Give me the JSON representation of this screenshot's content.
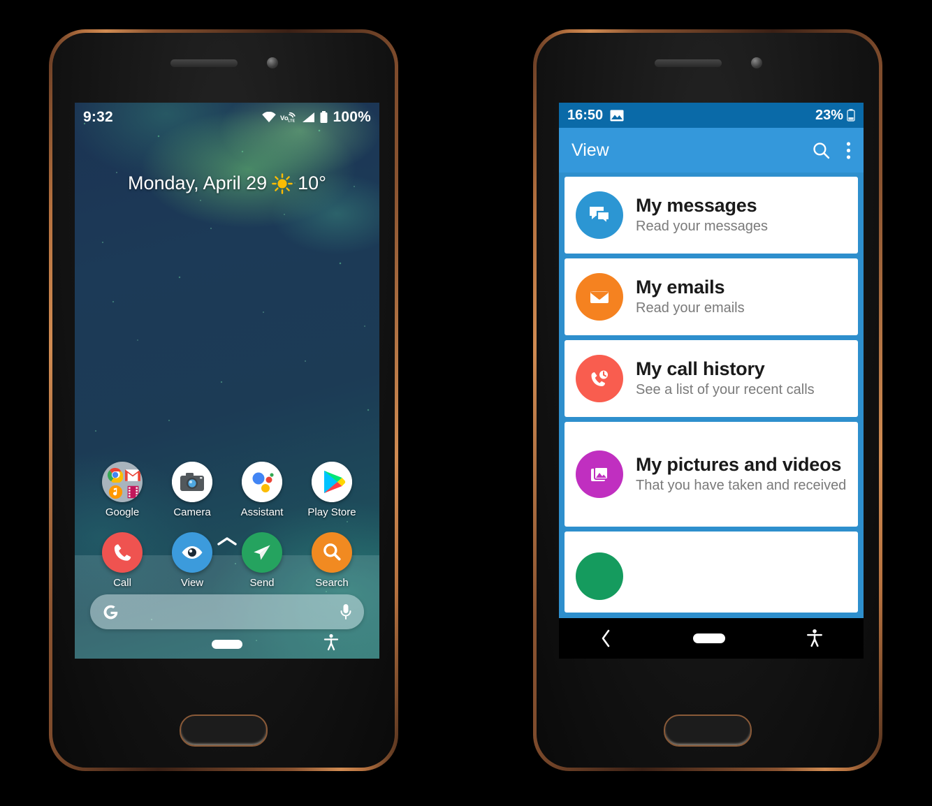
{
  "left_phone": {
    "name": "android-home-screen",
    "status_bar": {
      "time": "9:32",
      "wifi_icon": "wifi-icon",
      "volte_icon": "volte-icon",
      "signal_icon": "cellular-signal-icon",
      "battery_icon": "battery-icon",
      "battery_percent": "100%"
    },
    "date_widget": {
      "date": "Monday, April 29",
      "weather_icon": "sun-icon",
      "temperature": "10°"
    },
    "apps": [
      {
        "label": "Google",
        "icon": "google-folder-icon"
      },
      {
        "label": "Camera",
        "icon": "camera-icon"
      },
      {
        "label": "Assistant",
        "icon": "google-assistant-icon"
      },
      {
        "label": "Play Store",
        "icon": "play-store-icon"
      }
    ],
    "app_drawer_handle_icon": "chevron-up-icon",
    "dock": [
      {
        "label": "Call",
        "icon": "phone-icon",
        "color": "#EF5350"
      },
      {
        "label": "View",
        "icon": "eye-icon",
        "color": "#3C9BDC"
      },
      {
        "label": "Send",
        "icon": "paper-plane-icon",
        "color": "#25A35F"
      },
      {
        "label": "Search",
        "icon": "magnifier-icon",
        "color": "#F18A21"
      }
    ],
    "search_widget": {
      "logo_icon": "google-g-icon",
      "mic_icon": "microphone-icon",
      "query": ""
    },
    "nav_bar": {
      "home_icon": "home-pill-icon",
      "accessibility_icon": "accessibility-icon"
    }
  },
  "right_phone": {
    "name": "view-app-screen",
    "status_bar": {
      "time": "16:50",
      "notification_icon": "image-notification-icon",
      "battery_percent": "23%",
      "battery_icon": "battery-icon"
    },
    "app_bar": {
      "title": "View",
      "search_icon": "search-icon",
      "overflow_icon": "more-vertical-icon"
    },
    "cards": [
      {
        "title": "My messages",
        "subtitle": "Read your messages",
        "icon": "chat-bubbles-icon",
        "color": "#2C96D3"
      },
      {
        "title": "My emails",
        "subtitle": "Read your emails",
        "icon": "envelope-icon",
        "color": "#F58220"
      },
      {
        "title": "My call history",
        "subtitle": "See a list of your recent calls",
        "icon": "phone-history-icon",
        "color": "#F95D4F"
      },
      {
        "title": "My pictures and videos",
        "subtitle": "That you have taken and received",
        "icon": "photo-library-icon",
        "color": "#C02FC0"
      },
      {
        "title": "",
        "subtitle": "",
        "icon": "green-circle-icon",
        "color": "#159B5E"
      }
    ],
    "nav_bar": {
      "back_icon": "back-chevron-icon",
      "home_icon": "home-pill-icon",
      "accessibility_icon": "accessibility-icon"
    }
  },
  "theme": {
    "status_bar_blue": "#0a6aa8",
    "app_bar_blue": "#3498db",
    "card_list_blue": "#2e8fcd",
    "card_white": "#ffffff",
    "title_black": "#1a1a1a",
    "subtitle_grey": "#7a7a7a",
    "phone_frame_copper": "#b5713f"
  }
}
